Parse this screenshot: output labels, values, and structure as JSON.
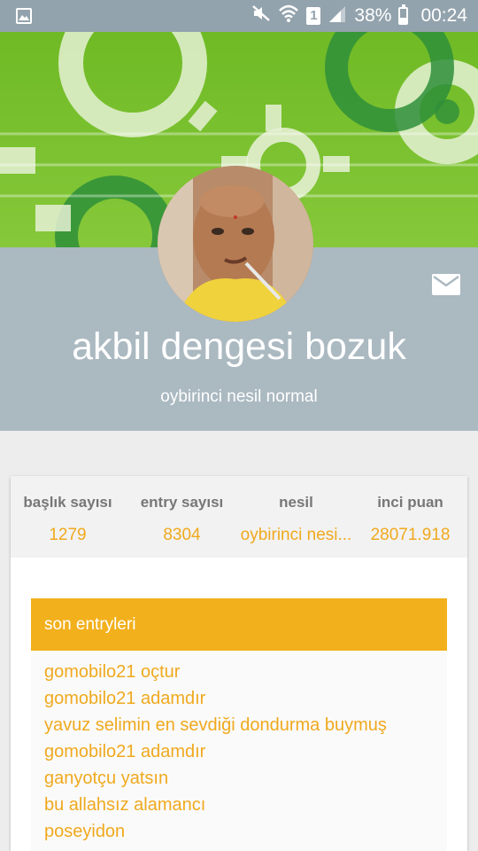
{
  "status_bar": {
    "battery_percent": "38%",
    "time": "00:24",
    "sim_slot": "1"
  },
  "profile": {
    "nick": "akbil dengesi bozuk",
    "generation_label": "oybirinci nesil normal"
  },
  "stats": [
    {
      "label": "başlık sayısı",
      "value": "1279"
    },
    {
      "label": "entry sayısı",
      "value": "8304"
    },
    {
      "label": "nesil",
      "value": "oybirinci nesi..."
    },
    {
      "label": "inci puan",
      "value": "28071.918"
    }
  ],
  "recent": {
    "title": "son entryleri",
    "items": [
      "gomobilo21 oçtur",
      "gomobilo21 adamdır",
      "yavuz selimin en sevdiği dondurma buymuş",
      "gomobilo21 adamdır",
      "ganyotçu yatsın",
      "bu allahsız alamancı",
      "poseyidon"
    ]
  },
  "colors": {
    "accent": "#f2b01c",
    "link": "#f0a91e",
    "profile_band": "#abb9c1",
    "banner_green": "#7cc22f"
  }
}
